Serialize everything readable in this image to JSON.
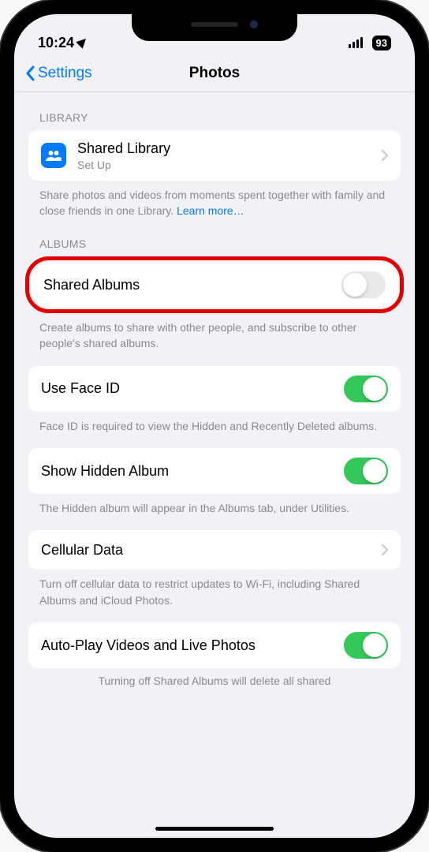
{
  "status": {
    "time": "10:24",
    "battery": "93"
  },
  "nav": {
    "back": "Settings",
    "title": "Photos"
  },
  "sections": {
    "library": {
      "header": "LIBRARY",
      "shared_library": {
        "title": "Shared Library",
        "subtitle": "Set Up"
      },
      "footer": "Share photos and videos from moments spent together with family and close friends in one Library.",
      "learn_more": "Learn more…"
    },
    "albums": {
      "header": "ALBUMS",
      "shared_albums": {
        "title": "Shared Albums",
        "enabled": false
      },
      "footer": "Create albums to share with other people, and subscribe to other people's shared albums."
    },
    "face_id": {
      "title": "Use Face ID",
      "enabled": true,
      "footer": "Face ID is required to view the Hidden and Recently Deleted albums."
    },
    "hidden": {
      "title": "Show Hidden Album",
      "enabled": true,
      "footer": "The Hidden album will appear in the Albums tab, under Utilities."
    },
    "cellular": {
      "title": "Cellular Data",
      "footer": "Turn off cellular data to restrict updates to Wi-Fi, including Shared Albums and iCloud Photos."
    },
    "autoplay": {
      "title": "Auto-Play Videos and Live Photos",
      "enabled": true,
      "footer_partial": "Turning off Shared Albums will delete all shared"
    }
  }
}
